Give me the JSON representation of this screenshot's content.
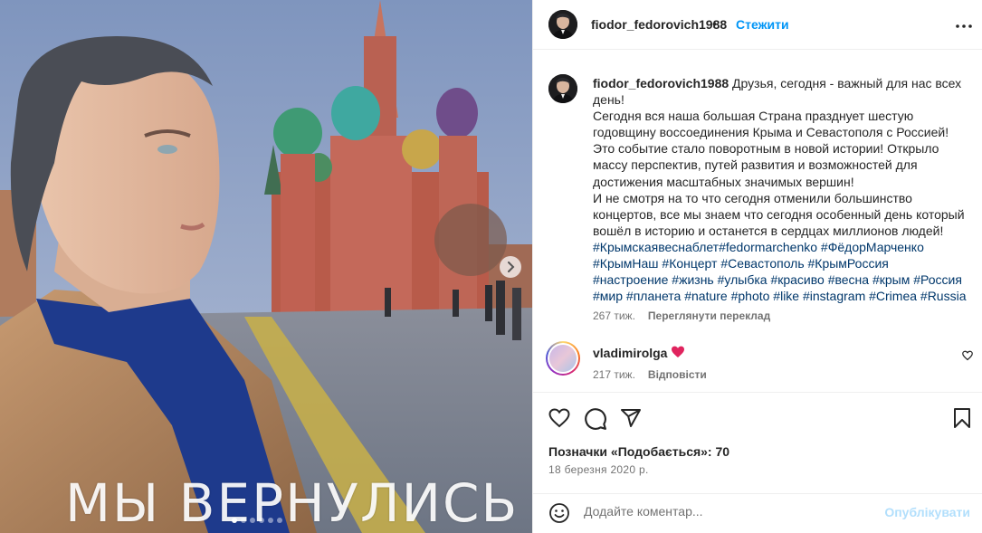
{
  "post": {
    "photo_caption": "МЫ ВЕРНУЛИСЬ",
    "carousel_dots": 6,
    "active_dot": 0
  },
  "header": {
    "username": "fiodor_fedorovich1988",
    "separator": "•",
    "follow_label": "Стежити"
  },
  "caption": {
    "username": "fiodor_fedorovich1988",
    "lines": [
      "Друзья, сегодня - важный для нас всех",
      "день!",
      "Сегодня вся наша большая Страна празднует шестую",
      "годовщину воссоединения Крыма и Севастополя с Россией!",
      "Это событие стало поворотным в новой истории! Открыло",
      "массу перспектив, путей развития и возможностей для",
      "достижения масштабных значимых вершин!",
      "И не смотря на то что сегодня отменили большинство",
      "концертов, все мы знаем что сегодня особенный день который",
      "вошёл в историю и останется в сердцах миллионов людей!"
    ],
    "hashtag_lines": [
      "#Крымскаявеснаблет#fedormarchenko #ФёдорМарченко",
      "#КрымНаш #Концерт #Севастополь #КрымРоссия",
      "#настроение #жизнь #улыбка #красиво #весна #крым #Россия",
      "#мир #планета #nature #photo #like #instagram #Crimea #Russia"
    ],
    "time": "267 тиж.",
    "translate_label": "Переглянути переклад"
  },
  "reply": {
    "username": "vladimirolga",
    "text": "❤",
    "time": "217 тиж.",
    "reply_label": "Відповісти"
  },
  "stats": {
    "likes_label": "Позначки «Подобається»: 70",
    "date": "18 березня 2020 р."
  },
  "comment_box": {
    "placeholder": "Додайте коментар...",
    "publish_label": "Опублікувати"
  },
  "colors": {
    "link": "#0095f6",
    "hashtag": "#00376b",
    "secondary": "#737373",
    "publish_disabled": "#b2dffc"
  }
}
